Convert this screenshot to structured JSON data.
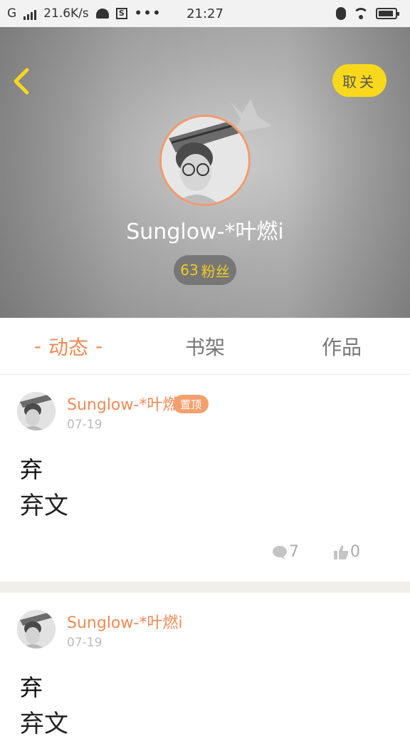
{
  "status_bar": {
    "network": "G",
    "speed": "21.6K/s",
    "time": "21:27",
    "more": "•••",
    "s_badge": "S"
  },
  "header": {
    "follow_label": "取关",
    "username": "Sunglow-*叶燃i",
    "fans_count": "63",
    "fans_label": "粉丝"
  },
  "tabs": [
    {
      "label": "动态",
      "active": true,
      "dash": "-"
    },
    {
      "label": "书架",
      "active": false
    },
    {
      "label": "作品",
      "active": false
    }
  ],
  "posts": [
    {
      "author": "Sunglow-*叶燃i",
      "pinned_label": "置顶",
      "date": "07-19",
      "title": "弃",
      "body": "弃文",
      "comments": "7",
      "likes": "0"
    },
    {
      "author": "Sunglow-*叶燃i",
      "date": "07-19",
      "title": "弃",
      "body": "弃文"
    }
  ],
  "colors": {
    "accent": "#f08a55",
    "follow_button": "#f8d81c",
    "fans_text": "#f2cc20"
  },
  "icons": [
    "back-arrow-icon",
    "crown-icon",
    "comment-icon",
    "like-icon",
    "bluetooth-icon",
    "wifi-icon",
    "battery-icon",
    "signal-icon",
    "android-icon"
  ]
}
